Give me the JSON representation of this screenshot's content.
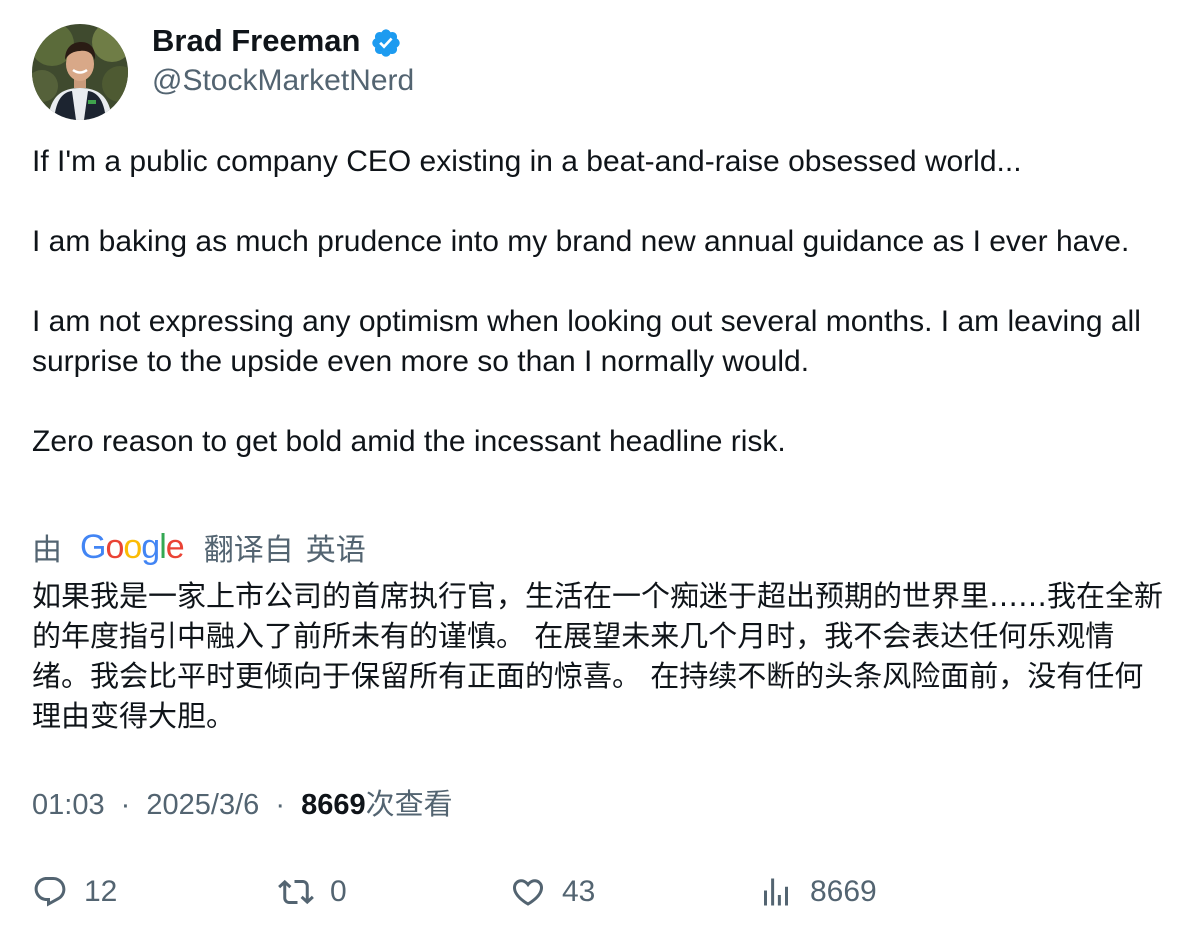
{
  "author": {
    "display_name": "Brad Freeman",
    "handle": "@StockMarketNerd",
    "verified": true,
    "verified_color": "#1d9bf0",
    "avatar_icon": "profile-photo"
  },
  "tweet": {
    "paragraphs": [
      "If I'm a public company CEO existing in a beat-and-raise obsessed world...",
      "I am baking as much prudence into my brand new annual guidance as I ever have.",
      "I am not expressing any optimism when looking out several months. I am leaving all surprise to the upside even more so than I normally would.",
      "Zero reason to get bold amid the incessant headline risk."
    ]
  },
  "translation": {
    "prefix": "由",
    "provider": "Google",
    "suffix": "翻译自",
    "language": "英语",
    "text": "如果我是一家上市公司的首席执行官，生活在一个痴迷于超出预期的世界里……我在全新的年度指引中融入了前所未有的谨慎。 在展望未来几个月时，我不会表达任何乐观情绪。我会比平时更倾向于保留所有正面的惊喜。 在持续不断的头条风险面前，没有任何理由变得大胆。"
  },
  "meta": {
    "time": "01:03",
    "separator": "·",
    "date": "2025/3/6",
    "views_count": "8669",
    "views_label": "次查看"
  },
  "actions": {
    "reply_count": "12",
    "retweet_count": "0",
    "like_count": "43",
    "views_count": "8669"
  },
  "colors": {
    "text_primary": "#0f1419",
    "text_secondary": "#536471",
    "google_blue": "#4285F4",
    "google_red": "#EA4335",
    "google_yellow": "#FBBC05",
    "google_green": "#34A853"
  }
}
